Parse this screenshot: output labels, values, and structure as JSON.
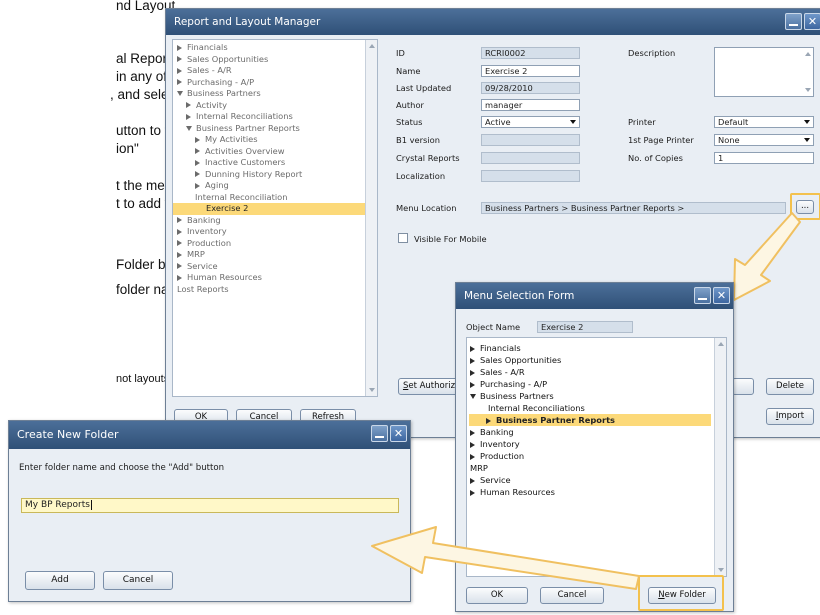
{
  "slide": {
    "lines": [
      "nd Layout",
      "al Report (not",
      "in any of the",
      ",  and select it",
      "utton to the right",
      "ion\"",
      "t the menu/folder",
      "t to add your",
      "Folder button",
      "folder name",
      "not layouts"
    ]
  },
  "report_manager": {
    "title": "Report and Layout Manager",
    "tree": [
      {
        "label": "Financials",
        "exp": "r"
      },
      {
        "label": "Sales Opportunities",
        "exp": "r"
      },
      {
        "label": "Sales - A/R",
        "exp": "r"
      },
      {
        "label": "Purchasing - A/P",
        "exp": "r"
      },
      {
        "label": "Business Partners",
        "exp": "d"
      },
      {
        "label": "Activity",
        "exp": "r"
      },
      {
        "label": "Internal Reconciliations",
        "exp": "r"
      },
      {
        "label": "Business Partner Reports",
        "exp": "d"
      },
      {
        "label": "My Activities",
        "exp": "r"
      },
      {
        "label": "Activities Overview",
        "exp": "r"
      },
      {
        "label": "Inactive Customers",
        "exp": "r"
      },
      {
        "label": "Dunning History Report",
        "exp": "r"
      },
      {
        "label": "Aging",
        "exp": "r"
      },
      {
        "label": "Internal Reconciliation",
        "exp": ""
      },
      {
        "label": "Exercise 2",
        "exp": "",
        "selected": true
      },
      {
        "label": "Banking",
        "exp": "r"
      },
      {
        "label": "Inventory",
        "exp": "r"
      },
      {
        "label": "Production",
        "exp": "r"
      },
      {
        "label": "MRP",
        "exp": "r"
      },
      {
        "label": "Service",
        "exp": "r"
      },
      {
        "label": "Human Resources",
        "exp": "r"
      },
      {
        "label": "Lost Reports",
        "exp": ""
      }
    ],
    "form": {
      "id_label": "ID",
      "id_value": "RCRI0002",
      "name_label": "Name",
      "name_value": "Exercise 2",
      "updated_label": "Last Updated",
      "updated_value": "09/28/2010",
      "author_label": "Author",
      "author_value": "manager",
      "status_label": "Status",
      "status_value": "Active",
      "b1_label": "B1 version",
      "crystal_label": "Crystal Reports",
      "localization_label": "Localization",
      "description_label": "Description",
      "printer_label": "Printer",
      "printer_value": "Default",
      "first_printer_label": "1st Page Printer",
      "first_printer_value": "None",
      "copies_label": "No. of Copies",
      "copies_value": "1",
      "menu_location_label": "Menu Location",
      "menu_location_value": "Business Partners > Business Partner Reports >",
      "browse_label": "...",
      "visible_mobile_label": "Visible For Mobile"
    },
    "buttons": {
      "set_auth": "Set Authoriz",
      "delete": "Delete",
      "import": "Import",
      "ok": "OK",
      "cancel": "Cancel",
      "refresh": "Refresh"
    }
  },
  "menu_selection": {
    "title": "Menu Selection Form",
    "object_name_label": "Object Name",
    "object_name_value": "Exercise 2",
    "tree": [
      {
        "label": "Financials",
        "exp": "r"
      },
      {
        "label": "Sales Opportunities",
        "exp": "r"
      },
      {
        "label": "Sales - A/R",
        "exp": "r"
      },
      {
        "label": "Purchasing - A/P",
        "exp": "r"
      },
      {
        "label": "Business Partners",
        "exp": "d"
      },
      {
        "label": "Internal Reconciliations",
        "exp": ""
      },
      {
        "label": "Business Partner Reports",
        "exp": "r",
        "selected": true
      },
      {
        "label": "Banking",
        "exp": "r"
      },
      {
        "label": "Inventory",
        "exp": "r"
      },
      {
        "label": "Production",
        "exp": "r"
      },
      {
        "label": "MRP",
        "exp": ""
      },
      {
        "label": "Service",
        "exp": "r"
      },
      {
        "label": "Human Resources",
        "exp": "r"
      }
    ],
    "ok": "OK",
    "cancel": "Cancel",
    "new_folder": "New Folder"
  },
  "create_folder": {
    "title": "Create New Folder",
    "instruction": "Enter folder name and choose the \"Add\" button",
    "folder_name": "My BP Reports",
    "add": "Add",
    "cancel": "Cancel"
  },
  "colors": {
    "titlebar": "#3a5d88",
    "highlight": "#f3c14d",
    "selection": "#fcd979",
    "arrow_fill": "#fdf6e3",
    "arrow_stroke": "#f0c060"
  }
}
